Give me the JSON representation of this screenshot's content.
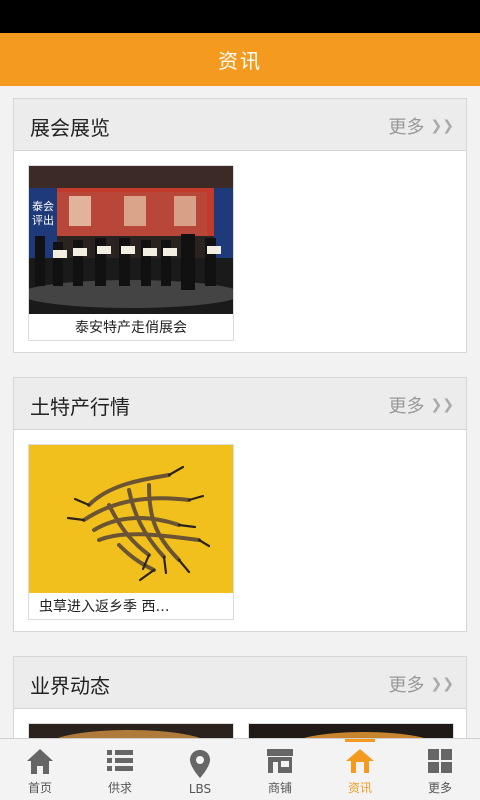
{
  "header": {
    "title": "资讯"
  },
  "sections": [
    {
      "title": "展会展览",
      "more_label": "更多",
      "more_icon": "double-chevron-right-icon",
      "items": [
        {
          "caption": "泰安特产走俏展会"
        }
      ]
    },
    {
      "title": "土特产行情",
      "more_label": "更多",
      "more_icon": "double-chevron-right-icon",
      "items": [
        {
          "caption": "虫草进入返乡季 西…"
        }
      ]
    },
    {
      "title": "业界动态",
      "more_label": "更多",
      "more_icon": "double-chevron-right-icon",
      "items": []
    }
  ],
  "photo_text": {
    "banner_line1": "泰会",
    "banner_line2": "评出"
  },
  "bottom_nav": [
    {
      "label": "首页",
      "icon": "home-icon"
    },
    {
      "label": "供求",
      "icon": "list-icon"
    },
    {
      "label": "LBS",
      "icon": "location-pin-icon"
    },
    {
      "label": "商铺",
      "icon": "shop-icon"
    },
    {
      "label": "资讯",
      "icon": "news-icon",
      "active": true
    },
    {
      "label": "更多",
      "icon": "grid-icon"
    }
  ],
  "colors": {
    "accent": "#f49b1f",
    "status_bar": "#000000"
  }
}
